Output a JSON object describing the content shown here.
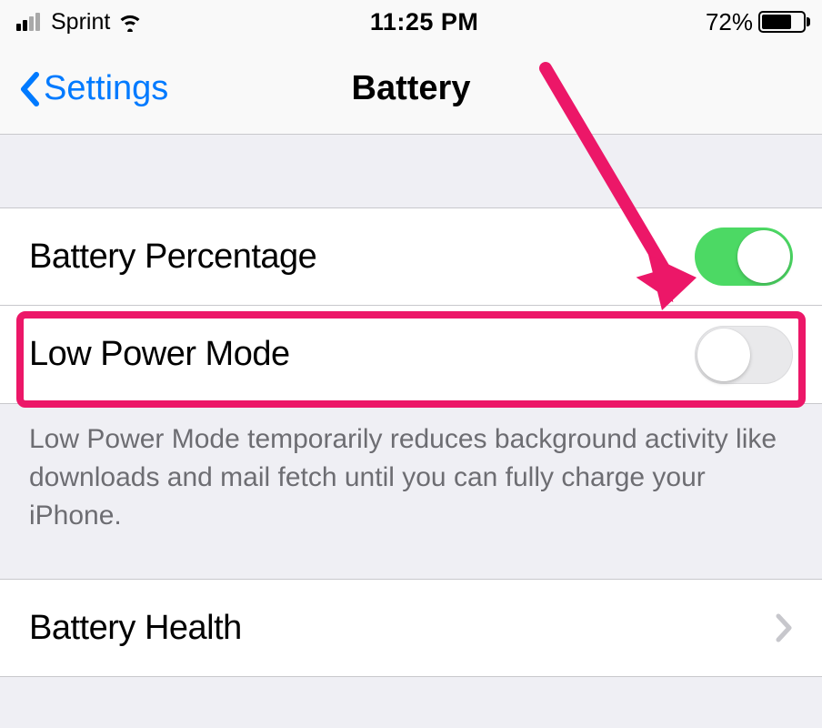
{
  "status_bar": {
    "carrier": "Sprint",
    "time": "11:25 PM",
    "battery_percent": "72%"
  },
  "nav": {
    "back_label": "Settings",
    "title": "Battery"
  },
  "cells": {
    "battery_percentage": {
      "label": "Battery Percentage",
      "toggle_on": true
    },
    "low_power_mode": {
      "label": "Low Power Mode",
      "toggle_on": false
    },
    "battery_health": {
      "label": "Battery Health"
    }
  },
  "footer": {
    "low_power_text": "Low Power Mode temporarily reduces background activity like downloads and mail fetch until you can fully charge your iPhone."
  },
  "colors": {
    "accent_blue": "#007aff",
    "toggle_green": "#4cd964",
    "separator": "#c8c8cc",
    "annotation_pink": "#ec1768"
  }
}
